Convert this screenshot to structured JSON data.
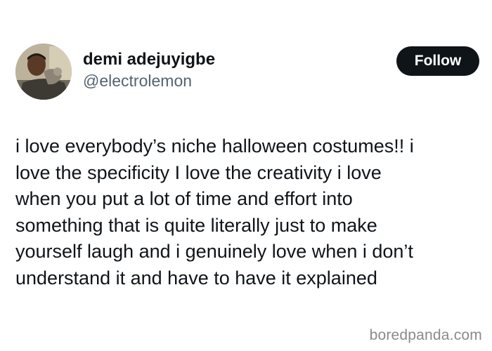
{
  "tweet": {
    "author": {
      "display_name": "demi adejuyigbe",
      "handle": "@electrolemon",
      "avatar": "profile-photo"
    },
    "follow_label": "Follow",
    "text_lines": [
      "i love everybody’s niche halloween costumes!! i",
      "love the specificity I love the creativity i love",
      "when you put a lot of time and effort into",
      "something that is quite literally just to make",
      "yourself laugh and i genuinely love when i don’t",
      "understand it and have to have it explained"
    ]
  },
  "watermark": "boredpanda.com",
  "colors": {
    "text": "#0f1419",
    "secondary_text": "#536471",
    "follow_button_bg": "#0f1419",
    "follow_button_text": "#ffffff",
    "watermark": "#8a8a8a"
  }
}
